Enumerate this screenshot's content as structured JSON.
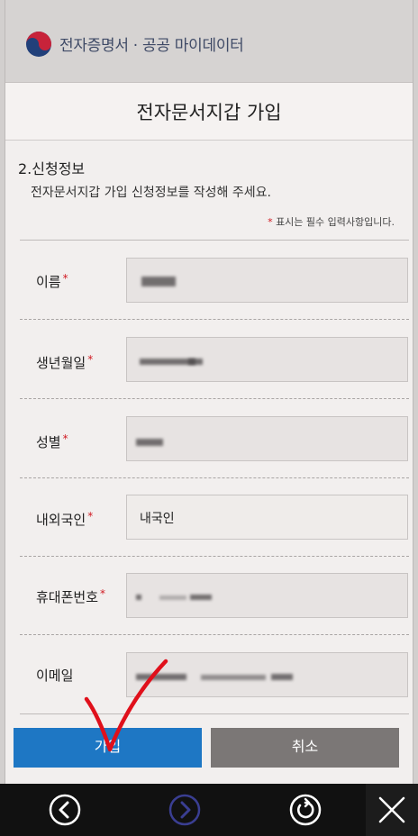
{
  "header": {
    "brand": "전자증명서 · 공공 마이데이터",
    "title": "전자문서지갑 가입"
  },
  "section": {
    "title": "2.신청정보",
    "description": "전자문서지갑 가입 신청정보를 작성해 주세요.",
    "required_note_star": "*",
    "required_note": "표시는 필수 입력사항입니다."
  },
  "form": {
    "fields": [
      {
        "label": "이름",
        "required": "*",
        "value": ""
      },
      {
        "label": "생년월일",
        "required": "*",
        "value": ""
      },
      {
        "label": "성별",
        "required": "*",
        "value": ""
      },
      {
        "label": "내외국인",
        "required": "*",
        "value": "내국인"
      },
      {
        "label": "휴대폰번호",
        "required": "*",
        "value": ""
      },
      {
        "label": "이메일",
        "required": "",
        "value": ""
      }
    ]
  },
  "buttons": {
    "join": "가입",
    "cancel": "취소"
  },
  "nav": {
    "icons": [
      "chevron-left-icon",
      "chevron-right-icon",
      "refresh-icon",
      "close-icon"
    ]
  },
  "colors": {
    "primary_button": "#1e77c4",
    "secondary_button": "#7b7776",
    "required_star": "#d11a22",
    "nav_background": "#111111",
    "annotation": "#e0101b"
  }
}
